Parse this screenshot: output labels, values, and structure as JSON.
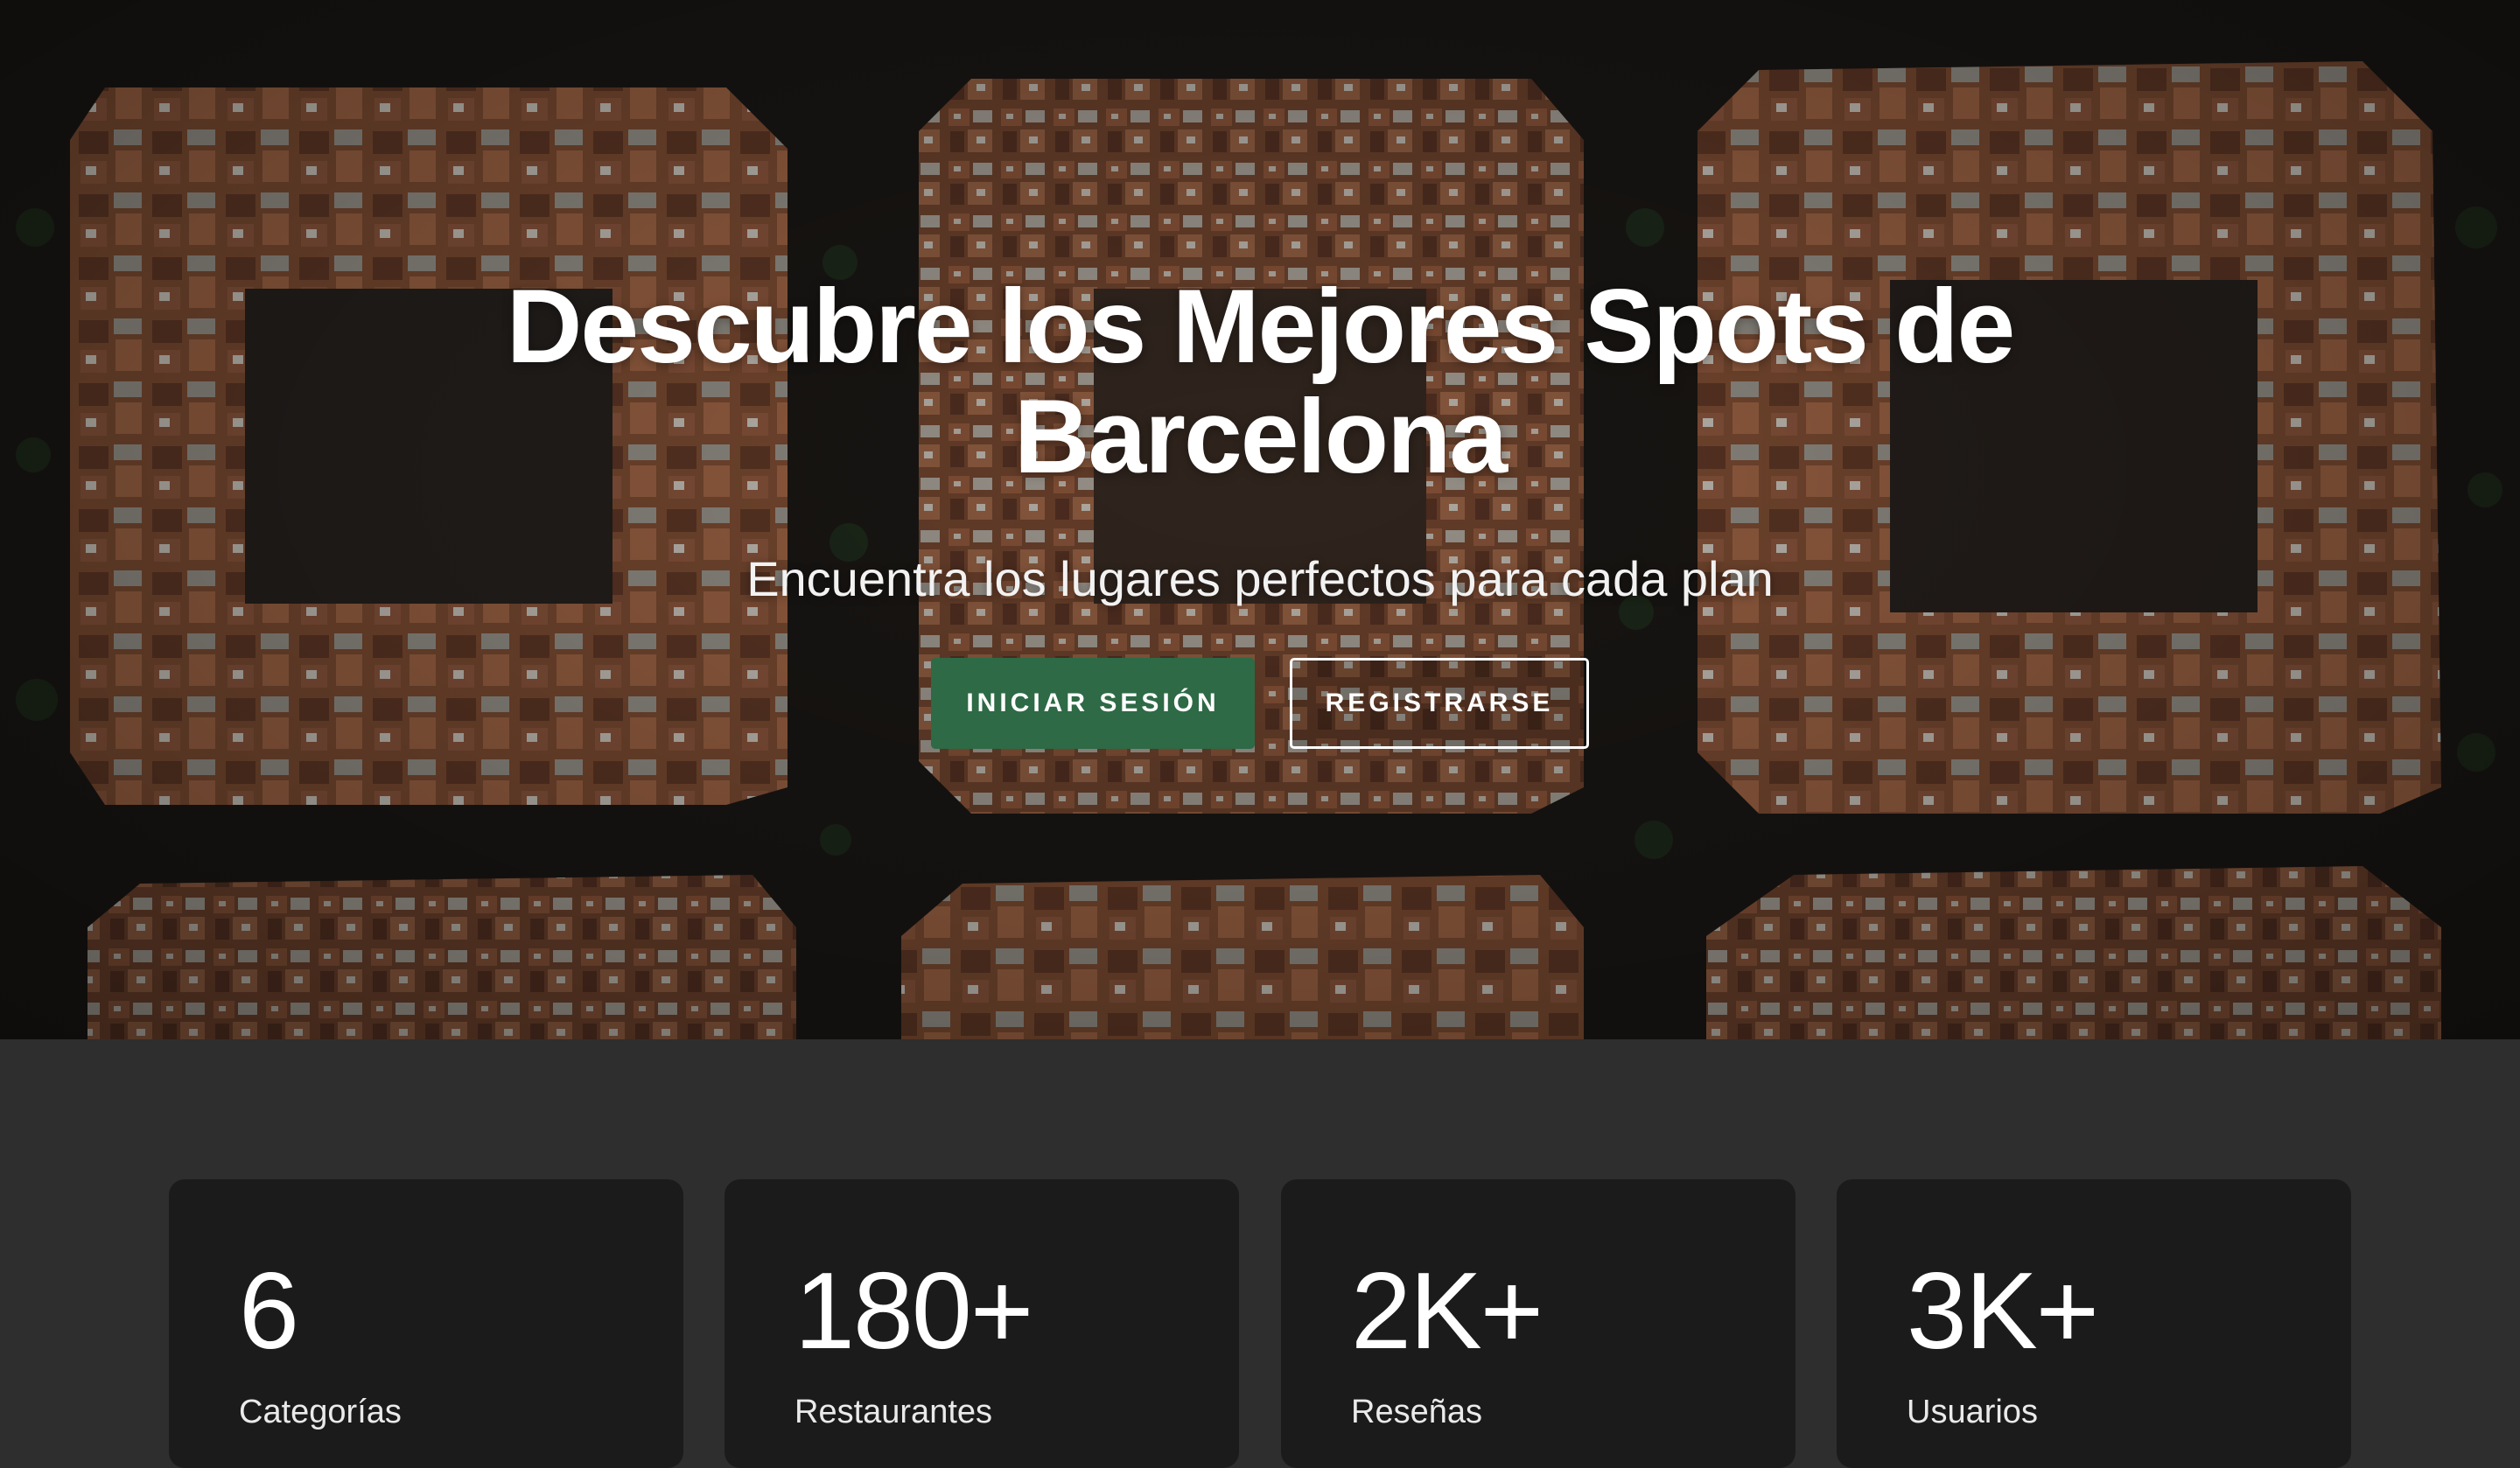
{
  "hero": {
    "title": "Descubre los Mejores Spots de Barcelona",
    "subtitle": "Encuentra los lugares perfectos para cada plan",
    "login_label": "INICIAR SESIÓN",
    "register_label": "REGISTRARSE",
    "background_image": "aerial-barcelona-eixample-blocks"
  },
  "stats": [
    {
      "value": "6",
      "label": "Categorías"
    },
    {
      "value": "180+",
      "label": "Restaurantes"
    },
    {
      "value": "2K+",
      "label": "Reseñas"
    },
    {
      "value": "3K+",
      "label": "Usuarios"
    }
  ],
  "colors": {
    "primary_button": "#2d6a45",
    "stats_background": "#2e2e2e",
    "card_background": "#1b1b1b",
    "text": "#ffffff"
  }
}
